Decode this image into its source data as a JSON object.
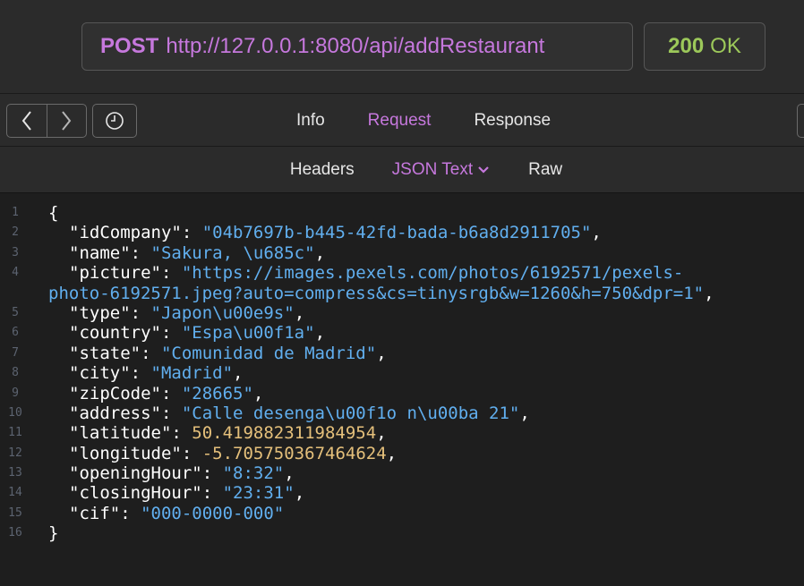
{
  "request_bar": {
    "method": "POST",
    "url": "http://127.0.0.1:8080/api/addRestaurant",
    "status_code": "200",
    "status_text": "OK"
  },
  "nav": {
    "back_icon": "chevron-left-icon",
    "forward_icon": "chevron-right-icon",
    "history_icon": "clock-icon",
    "tabs": [
      {
        "label": "Info",
        "active": false
      },
      {
        "label": "Request",
        "active": true
      },
      {
        "label": "Response",
        "active": false
      }
    ]
  },
  "subtabs": [
    {
      "label": "Headers",
      "active": false
    },
    {
      "label": "JSON Text",
      "active": true
    },
    {
      "label": "Raw",
      "active": false
    }
  ],
  "colors": {
    "accent": "#c678dd",
    "status_ok": "#9cc85a",
    "string": "#61afef",
    "number": "#e5c07b"
  },
  "json": {
    "open": "{",
    "close": "}",
    "fields": [
      {
        "key": "idCompany",
        "value": "04b7697b-b445-42fd-bada-b6a8d2911705",
        "kind": "string"
      },
      {
        "key": "name",
        "value": "Sakura, \\u685c",
        "kind": "string"
      },
      {
        "key": "picture",
        "value_part1": "https://images.pexels.com/photos/6192571/pexels-",
        "value_part2": "photo-6192571.jpeg?auto=compress&cs=tinysrgb&w=1260&h=750&dpr=1",
        "kind": "string-wrapped"
      },
      {
        "key": "type",
        "value": "Japon\\u00e9s",
        "kind": "string"
      },
      {
        "key": "country",
        "value": "Espa\\u00f1a",
        "kind": "string"
      },
      {
        "key": "state",
        "value": "Comunidad de Madrid",
        "kind": "string"
      },
      {
        "key": "city",
        "value": "Madrid",
        "kind": "string"
      },
      {
        "key": "zipCode",
        "value": "28665",
        "kind": "string"
      },
      {
        "key": "address",
        "value": "Calle desenga\\u00f1o n\\u00ba 21",
        "kind": "string"
      },
      {
        "key": "latitude",
        "value": "50.419882311984954",
        "kind": "number"
      },
      {
        "key": "longitude",
        "value": "-5.705750367464624",
        "kind": "number"
      },
      {
        "key": "openingHour",
        "value": "8:32",
        "kind": "string"
      },
      {
        "key": "closingHour",
        "value": "23:31",
        "kind": "string"
      },
      {
        "key": "cif",
        "value": "000-0000-000",
        "kind": "string",
        "last": true
      }
    ]
  }
}
